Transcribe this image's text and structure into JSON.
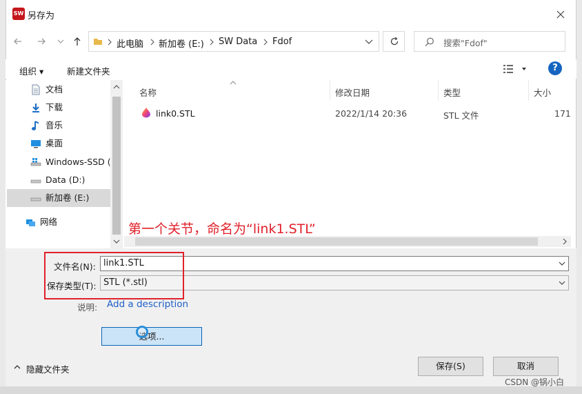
{
  "window": {
    "title": "另存为",
    "app_icon_text": "SW"
  },
  "nav": {
    "breadcrumb": [
      "此电脑",
      "新加卷 (E:)",
      "SW Data",
      "Fdof"
    ],
    "search_placeholder": "搜索\"Fdof\""
  },
  "toolbar": {
    "organize_label": "组织 ▾",
    "new_folder_label": "新建文件夹"
  },
  "sidebar": {
    "items": [
      {
        "label": "文档",
        "icon": "document-icon"
      },
      {
        "label": "下载",
        "icon": "download-icon"
      },
      {
        "label": "音乐",
        "icon": "music-icon"
      },
      {
        "label": "桌面",
        "icon": "desktop-icon"
      },
      {
        "label": "Windows-SSD (",
        "icon": "drive-icon"
      },
      {
        "label": "Data (D:)",
        "icon": "drive-icon"
      },
      {
        "label": "新加卷 (E:)",
        "icon": "drive-icon",
        "selected": true
      },
      {
        "label": "网络",
        "icon": "network-icon"
      }
    ]
  },
  "file_list": {
    "columns": [
      "名称",
      "修改日期",
      "类型",
      "大小"
    ],
    "rows": [
      {
        "name": "link0.STL",
        "modified": "2022/1/14 20:36",
        "type": "STL 文件",
        "size": "171"
      }
    ]
  },
  "annotation": "第一个关节，命名为“link1.STL”",
  "form": {
    "filename_label": "文件名(N):",
    "filename_value": "link1.STL",
    "filetype_label": "保存类型(T):",
    "filetype_value": "STL (*.stl)",
    "description_label": "说明:",
    "description_link": "Add a description",
    "options_button": "选项...",
    "hide_folders": "隐藏文件夹",
    "save_button": "保存(S)",
    "cancel_button": "取消"
  },
  "watermark": "CSDN @锅小白",
  "colors": {
    "annotation": "#e0202a",
    "link": "#1e5fc7",
    "accent": "#0a64b8"
  }
}
